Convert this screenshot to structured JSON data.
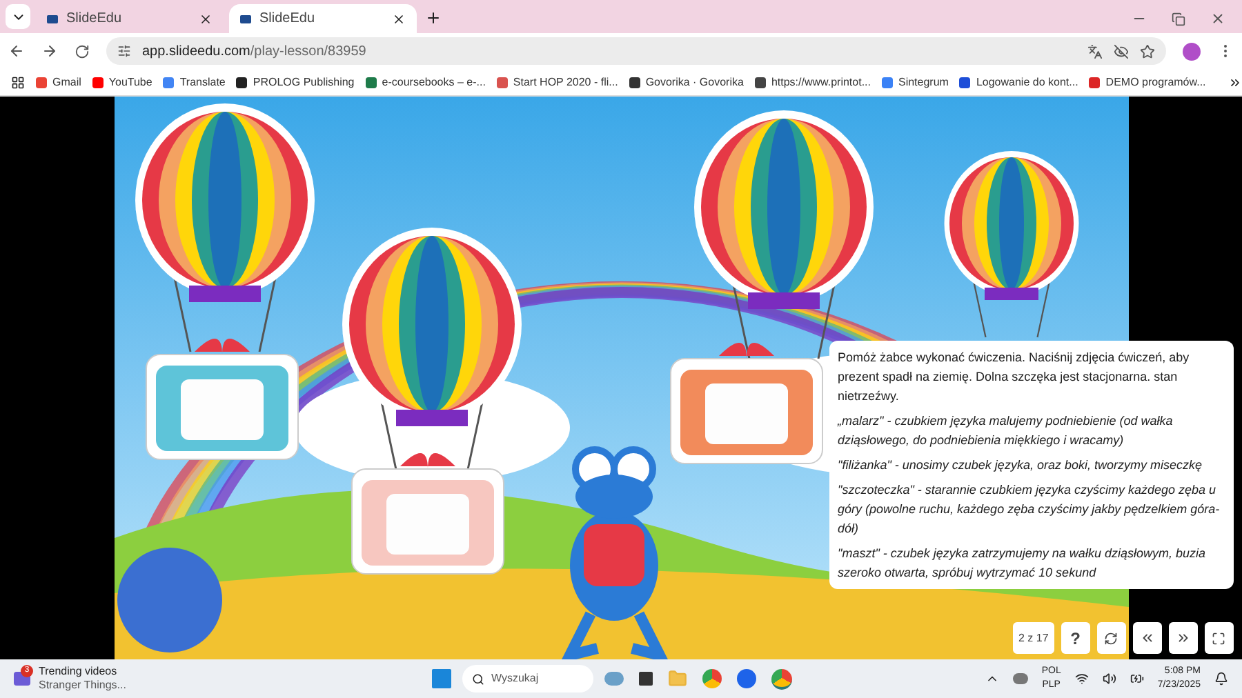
{
  "browser": {
    "tabs": [
      {
        "title": "SlideEdu",
        "selected": false
      },
      {
        "title": "SlideEdu",
        "selected": true
      }
    ],
    "url": {
      "host": "app.slideedu.com",
      "path": "/play-lesson/83959"
    },
    "bookmarks": [
      {
        "label": "Gmail",
        "color": "#ea4335"
      },
      {
        "label": "YouTube",
        "color": "#ff0000"
      },
      {
        "label": "Translate",
        "color": "#4285f4"
      },
      {
        "label": "PROLOG Publishing",
        "color": "#222222"
      },
      {
        "label": "e-coursebooks – e-...",
        "color": "#1e7b4a"
      },
      {
        "label": "Start HOP 2020 - fli...",
        "color": "#d9534f"
      },
      {
        "label": "Govorika · Govorika",
        "color": "#333333"
      },
      {
        "label": "https://www.printot...",
        "color": "#444444"
      },
      {
        "label": "Sintegrum",
        "color": "#3b82f6"
      },
      {
        "label": "Logowanie do kont...",
        "color": "#1d4ed8"
      },
      {
        "label": "DEMO programów...",
        "color": "#dc2626"
      }
    ]
  },
  "lesson": {
    "instructions": [
      {
        "kind": "plain",
        "text": "Pomóż żabce wykonać ćwiczenia. Naciśnij zdjęcia ćwiczeń, aby prezent spadł na ziemię. Dolna szczęka jest stacjonarna. stan nietrzeźwy."
      },
      {
        "kind": "exercise",
        "text": "„malarz\" - czubkiem języka malujemy podniebienie (od wałka dziąsłowego, do podniebienia miękkiego i wracamy)"
      },
      {
        "kind": "exercise",
        "text": "\"filiżanka\" - unosimy czubek języka, oraz boki, tworzymy miseczkę"
      },
      {
        "kind": "exercise",
        "text": "\"szczoteczka\" - starannie czubkiem języka czyścimy każdego zęba u góry (powolne ruchu, każdego zęba czyścimy jakby pędzelkiem góra-dół)"
      },
      {
        "kind": "exercise",
        "text": "\"maszt\" - czubek języka zatrzymujemy na wałku dziąsłowym, buzia szeroko otwarta, spróbuj wytrzymać 10 sekund"
      }
    ],
    "counter": "2 z 17",
    "help": "?"
  },
  "taskbar": {
    "widget": {
      "title": "Trending videos",
      "subtitle": "Stranger Things...",
      "badge": "3"
    },
    "search_placeholder": "Wyszukaj",
    "language": [
      "POL",
      "PLP"
    ],
    "time": "5:08 PM",
    "date": "7/23/2025"
  }
}
